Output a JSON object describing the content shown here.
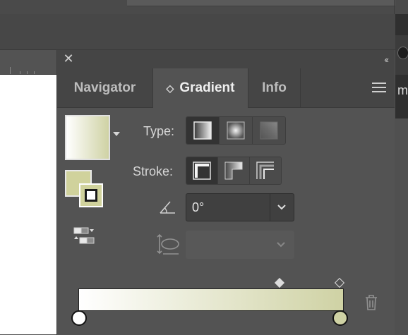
{
  "window": {
    "close_glyph": "✕",
    "collapse_glyph": "‹‹"
  },
  "tabs": [
    {
      "label": "Navigator",
      "active": false
    },
    {
      "label": "Gradient",
      "active": true
    },
    {
      "label": "Info",
      "active": false
    }
  ],
  "gradient": {
    "type_label": "Type:",
    "stroke_label": "Stroke:",
    "angle_value": "0°",
    "aspect_value": "",
    "type_options": [
      "linear-gradient-icon",
      "radial-gradient-icon",
      "freeform-gradient-icon"
    ],
    "type_selected": "linear-gradient-icon",
    "stroke_options": [
      "stroke-within-icon",
      "stroke-along-icon",
      "stroke-across-icon"
    ],
    "stroke_selected": "stroke-within-icon",
    "stops": [
      {
        "color": "#ffffff",
        "location_percent": 0
      },
      {
        "color": "#cfd2a4",
        "location_percent": 100
      }
    ],
    "midpoint_percent": 77
  },
  "background": {
    "right_edge_letter": "m"
  },
  "colors": {
    "panel_bg": "#535353",
    "tab_bar_bg": "#454545",
    "gradient_end": "#cfd2a4"
  }
}
